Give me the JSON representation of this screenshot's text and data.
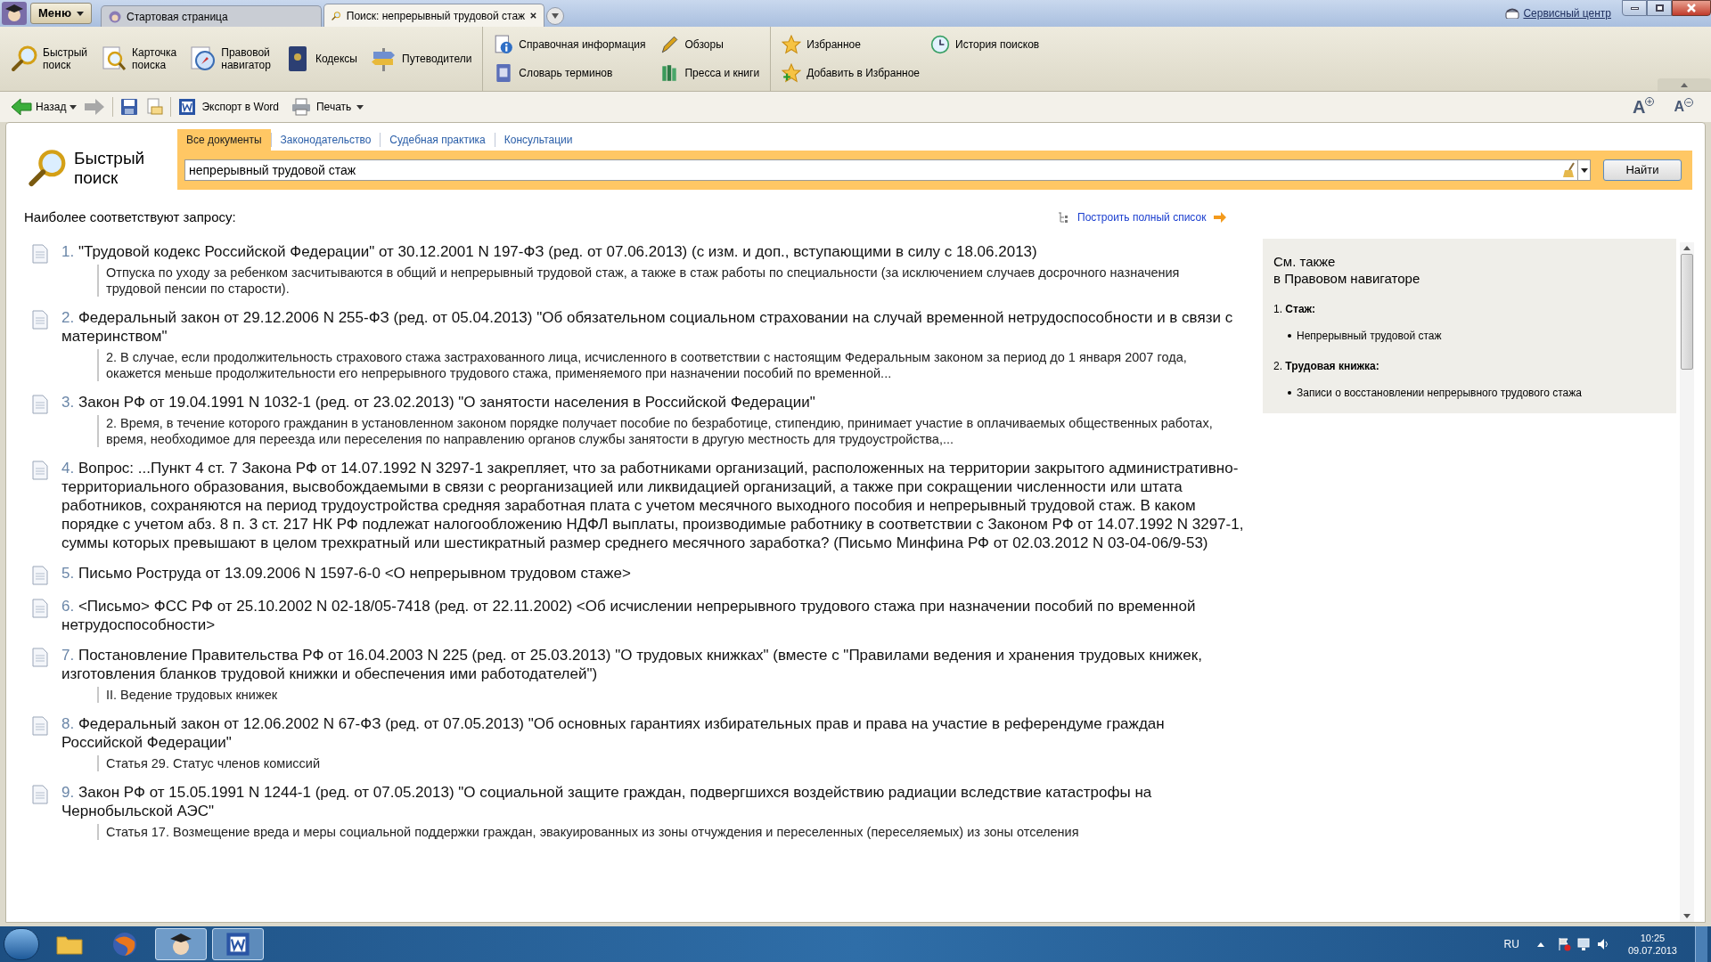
{
  "app_menu": {
    "label": "Меню"
  },
  "tabs": [
    {
      "label": "Стартовая страница",
      "selected": false
    },
    {
      "label": "Поиск: непрерывный трудовой стаж",
      "selected": true
    }
  ],
  "service_link": "Сервисный центр",
  "ribbon": {
    "large": [
      {
        "kind": "search",
        "label": "Быстрый поиск"
      },
      {
        "kind": "card",
        "label": "Карточка поиска"
      },
      {
        "kind": "navigator",
        "label": "Правовой навигатор"
      },
      {
        "kind": "book",
        "label": "Кодексы"
      },
      {
        "kind": "signpost",
        "label": "Путеводители"
      }
    ],
    "small": [
      {
        "kind": "info",
        "label": "Справочная информация"
      },
      {
        "kind": "pen",
        "label": "Обзоры"
      },
      {
        "kind": "star",
        "label": "Избранное"
      },
      {
        "kind": "clock",
        "label": "История поисков"
      },
      {
        "kind": "dictionary",
        "label": "Словарь терминов"
      },
      {
        "kind": "books",
        "label": "Пресса и книги"
      },
      {
        "kind": "star-add",
        "label": "Добавить в Избранное"
      }
    ]
  },
  "toolbar": {
    "back": "Назад",
    "export": "Экспорт в Word",
    "print": "Печать",
    "font_increase": "A",
    "font_decrease": "A"
  },
  "search": {
    "title": "Быстрый поиск",
    "tabs": [
      {
        "label": "Все документы",
        "selected": true
      },
      {
        "label": "Законодательство",
        "selected": false
      },
      {
        "label": "Судебная практика",
        "selected": false
      },
      {
        "label": "Консультации",
        "selected": false
      }
    ],
    "value": "непрерывный трудовой стаж",
    "button": "Найти"
  },
  "results_heading": "Наиболее соответствуют запросу:",
  "full_list_link": "Построить полный список",
  "results": [
    {
      "number": "1.",
      "title": "\"Трудовой кодекс Российской Федерации\" от 30.12.2001 N 197-ФЗ (ред. от 07.06.2013) (с изм. и доп., вступающими в силу с 18.06.2013)",
      "snippet": "Отпуска по уходу за ребенком засчитываются в общий и непрерывный трудовой стаж, а также в стаж работы по специальности (за исключением случаев досрочного назначения трудовой пенсии по старости)."
    },
    {
      "number": "2.",
      "title": "Федеральный закон от 29.12.2006 N 255-ФЗ (ред. от 05.04.2013) \"Об обязательном социальном страховании на случай временной нетрудоспособности и в связи с материнством\"",
      "snippet": "2. В случае, если продолжительность страхового стажа застрахованного лица, исчисленного в соответствии с настоящим Федеральным законом за период до 1 января 2007 года, окажется меньше продолжительности его непрерывного трудового стажа, применяемого при назначении пособий по временной..."
    },
    {
      "number": "3.",
      "title": "Закон РФ от 19.04.1991 N 1032-1 (ред. от 23.02.2013) \"О занятости населения в Российской Федерации\"",
      "snippet": "2. Время, в течение которого гражданин в установленном законом порядке получает пособие по безработице, стипендию, принимает участие в оплачиваемых общественных работах, время, необходимое для переезда или переселения по направлению органов службы занятости в другую местность для трудоустройства,..."
    },
    {
      "number": "4.",
      "title": "Вопрос: ...Пункт 4 ст. 7 Закона РФ от 14.07.1992 N 3297-1 закрепляет, что за работниками организаций, расположенных на территории закрытого административно-территориального образования, высвобождаемыми в связи с реорганизацией или ликвидацией организаций, а также при сокращении численности или штата работников, сохраняются на период трудоустройства средняя заработная плата с учетом месячного выходного пособия и непрерывный трудовой стаж. В каком порядке с учетом абз. 8 п. 3 ст. 217 НК РФ подлежат налогообложению НДФЛ выплаты, производимые работнику в соответствии с Законом РФ от 14.07.1992 N 3297-1, суммы которых превышают в целом трехкратный или шестикратный размер среднего месячного заработка? (Письмо Минфина РФ от 02.03.2012 N 03-04-06/9-53)"
    },
    {
      "number": "5.",
      "title": "Письмо Роструда от 13.09.2006 N 1597-6-0 <О непрерывном трудовом стаже>"
    },
    {
      "number": "6.",
      "title": "<Письмо> ФСС РФ от 25.10.2002 N 02-18/05-7418 (ред. от 22.11.2002) <Об исчислении непрерывного трудового стажа при назначении пособий по временной нетрудоспособности>"
    },
    {
      "number": "7.",
      "title": "Постановление Правительства РФ от 16.04.2003 N 225 (ред. от 25.03.2013) \"О трудовых книжках\" (вместе с \"Правилами ведения и хранения трудовых книжек, изготовления бланков трудовой книжки и обеспечения ими работодателей\")",
      "snippet": "II. Ведение трудовых книжек"
    },
    {
      "number": "8.",
      "title": "Федеральный закон от 12.06.2002 N 67-ФЗ (ред. от 07.05.2013) \"Об основных гарантиях избирательных прав и права на участие в референдуме граждан Российской Федерации\"",
      "snippet": "Статья 29. Статус членов комиссий"
    },
    {
      "number": "9.",
      "title": "Закон РФ от 15.05.1991 N 1244-1 (ред. от 07.05.2013) \"О социальной защите граждан, подвергшихся воздействию радиации вследствие катастрофы на Чернобыльской АЭС\"",
      "snippet": "Статья 17. Возмещение вреда и меры социальной поддержки граждан, эвакуированных из зоны отчуждения и переселенных (переселяемых) из зоны отселения"
    }
  ],
  "see_also": {
    "title": "См. также",
    "subtitle": "в Правовом навигаторе",
    "groups": [
      {
        "number": "1.",
        "label": "Стаж:",
        "items": [
          "Непрерывный трудовой стаж"
        ]
      },
      {
        "number": "2.",
        "label": "Трудовая книжка:",
        "items": [
          "Записи о восстановлении непрерывного трудового стажа"
        ]
      }
    ]
  },
  "taskbar": {
    "language": "RU",
    "time": "10:25",
    "date": "09.07.2013"
  }
}
